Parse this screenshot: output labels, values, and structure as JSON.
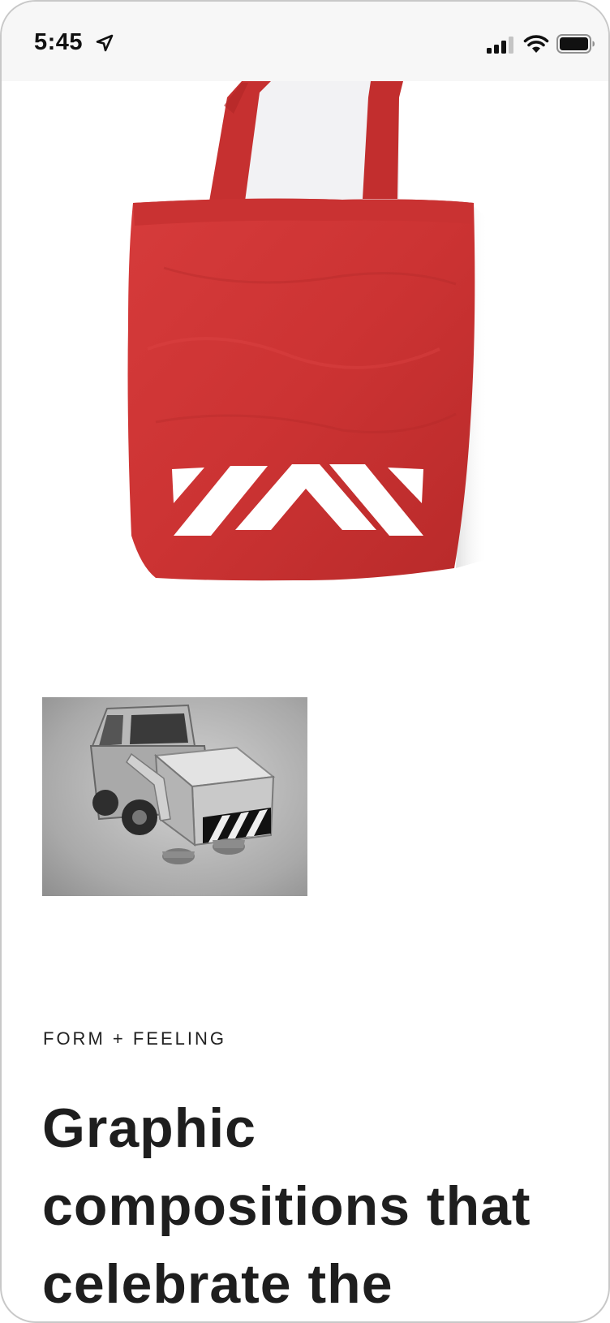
{
  "status_bar": {
    "time": "5:45",
    "icons": [
      "location-arrow-icon",
      "cellular-signal-icon",
      "wifi-icon",
      "battery-icon"
    ]
  },
  "hero_image": {
    "subject": "red tote bag with white chevron stripes",
    "colors": {
      "bag": "#cc3434",
      "stripes": "#ffffff"
    }
  },
  "secondary_image": {
    "subject": "grayscale toy street sweeper truck with hazard stripes"
  },
  "section": {
    "eyebrow": "FORM + FEELING",
    "headline": "Graphic compositions that celebrate the"
  },
  "colors": {
    "text": "#1e1e1e",
    "status_bar_bg": "#f7f7f7",
    "page_bg": "#ffffff"
  }
}
